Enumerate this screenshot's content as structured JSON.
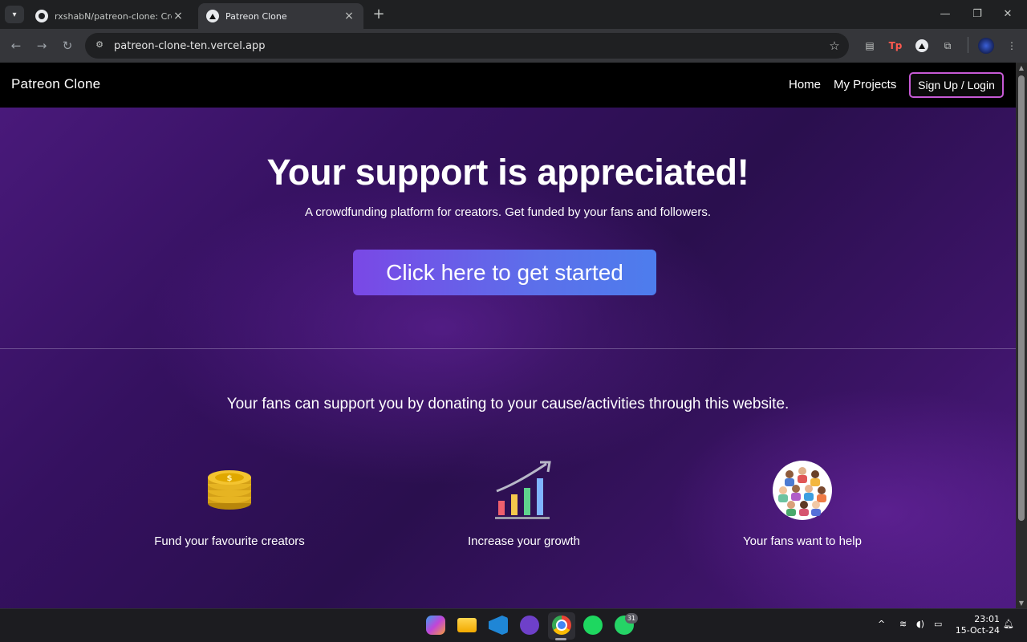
{
  "browser": {
    "tabs": [
      {
        "title": "rxshabN/patreon-clone: Created",
        "icon": "github-icon",
        "active": false
      },
      {
        "title": "Patreon Clone",
        "icon": "vercel-icon",
        "active": true
      }
    ],
    "url": "patreon-clone-ten.vercel.app"
  },
  "navbar": {
    "brand": "Patreon Clone",
    "links": [
      "Home",
      "My Projects"
    ],
    "login_label": "Sign Up / Login"
  },
  "hero": {
    "title": "Your support is appreciated!",
    "subtitle": "A crowdfunding platform for creators. Get funded by your fans and followers.",
    "cta_label": "Click here to get started"
  },
  "section": {
    "text": "Your fans can support you by donating to your cause/activities through this website.",
    "features": [
      {
        "icon": "coins-icon",
        "caption": "Fund your favourite creators"
      },
      {
        "icon": "growth-chart-icon",
        "caption": "Increase your growth"
      },
      {
        "icon": "fans-group-icon",
        "caption": "Your fans want to help"
      }
    ]
  },
  "taskbar": {
    "whatsapp_badge": "31",
    "time": "23:01",
    "date": "15-Oct-24"
  },
  "colors": {
    "accent_button_start": "#7a48e6",
    "accent_button_end": "#4d7ded",
    "login_border": "#c75ad6",
    "bg_purple": "#351160"
  }
}
